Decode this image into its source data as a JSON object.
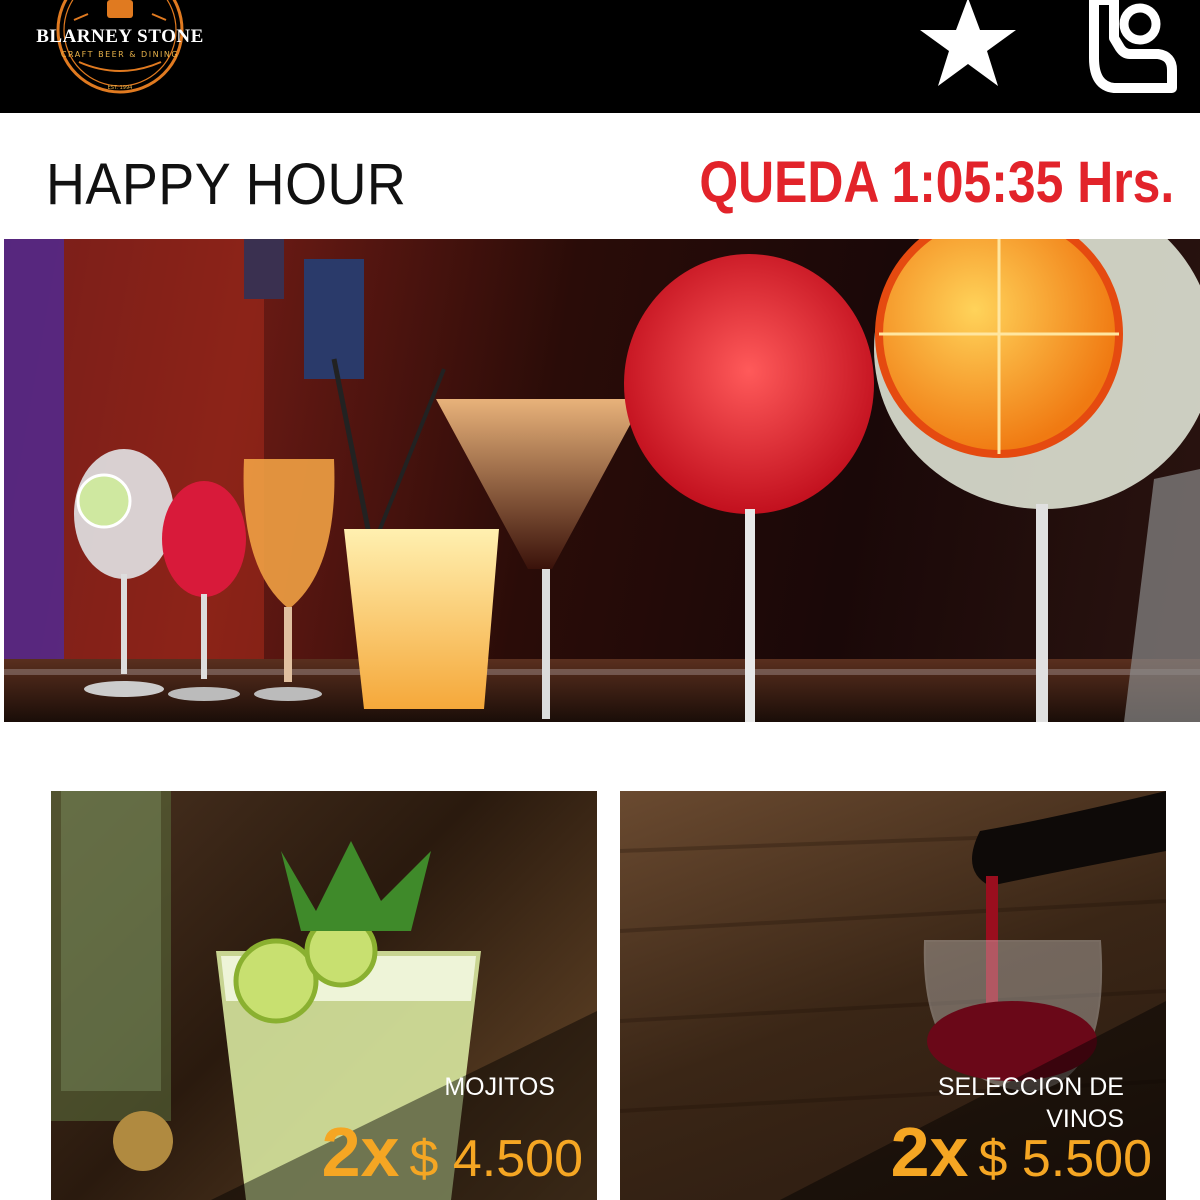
{
  "brand": {
    "name": "BLARNEY STONE",
    "tagline": "CRAFT BEER & DINING",
    "established": "EST. 1994"
  },
  "header": {
    "title": "HAPPY HOUR",
    "countdown": "QUEDA 1:05:35 Hrs."
  },
  "icons": {
    "favorite": "star-icon",
    "user": "user-raise-hand-icon"
  },
  "colors": {
    "topbar": "#000000",
    "countdown": "#e2232a",
    "price": "#f5a623"
  },
  "promos": [
    {
      "label": "MOJITOS",
      "multiplier": "2x",
      "price": "$ 4.500"
    },
    {
      "label": "SELECCION DE VINOS",
      "multiplier": "2x",
      "price": "$ 5.500"
    }
  ]
}
